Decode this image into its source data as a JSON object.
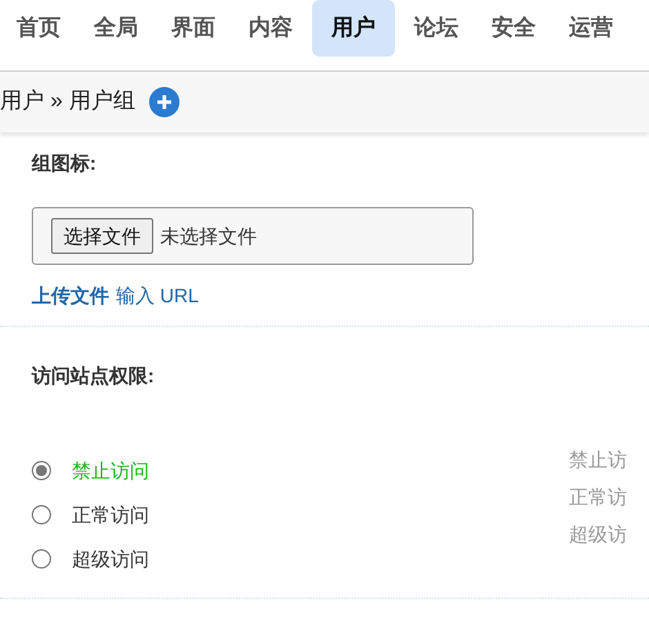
{
  "nav": [
    {
      "label": "首页",
      "selected": false
    },
    {
      "label": "全局",
      "selected": false
    },
    {
      "label": "界面",
      "selected": false
    },
    {
      "label": "内容",
      "selected": false
    },
    {
      "label": "用户",
      "selected": true
    },
    {
      "label": "论坛",
      "selected": false
    },
    {
      "label": "安全",
      "selected": false
    },
    {
      "label": "运营",
      "selected": false
    }
  ],
  "breadcrumb": {
    "parts": [
      "用户",
      "用户组"
    ],
    "separator": "»"
  },
  "group_icon": {
    "label": "组图标:",
    "file_button": "选择文件",
    "file_status": "未选择文件",
    "links": [
      {
        "label": "上传文件",
        "selected": true
      },
      {
        "label": "输入 URL",
        "selected": false
      }
    ]
  },
  "access": {
    "label": "访问站点权限:",
    "options": [
      {
        "label": "禁止访问",
        "selected": true
      },
      {
        "label": "正常访问",
        "selected": false
      },
      {
        "label": "超级访问",
        "selected": false
      }
    ],
    "hints": [
      "禁止访",
      "正常访",
      "超级访"
    ]
  }
}
